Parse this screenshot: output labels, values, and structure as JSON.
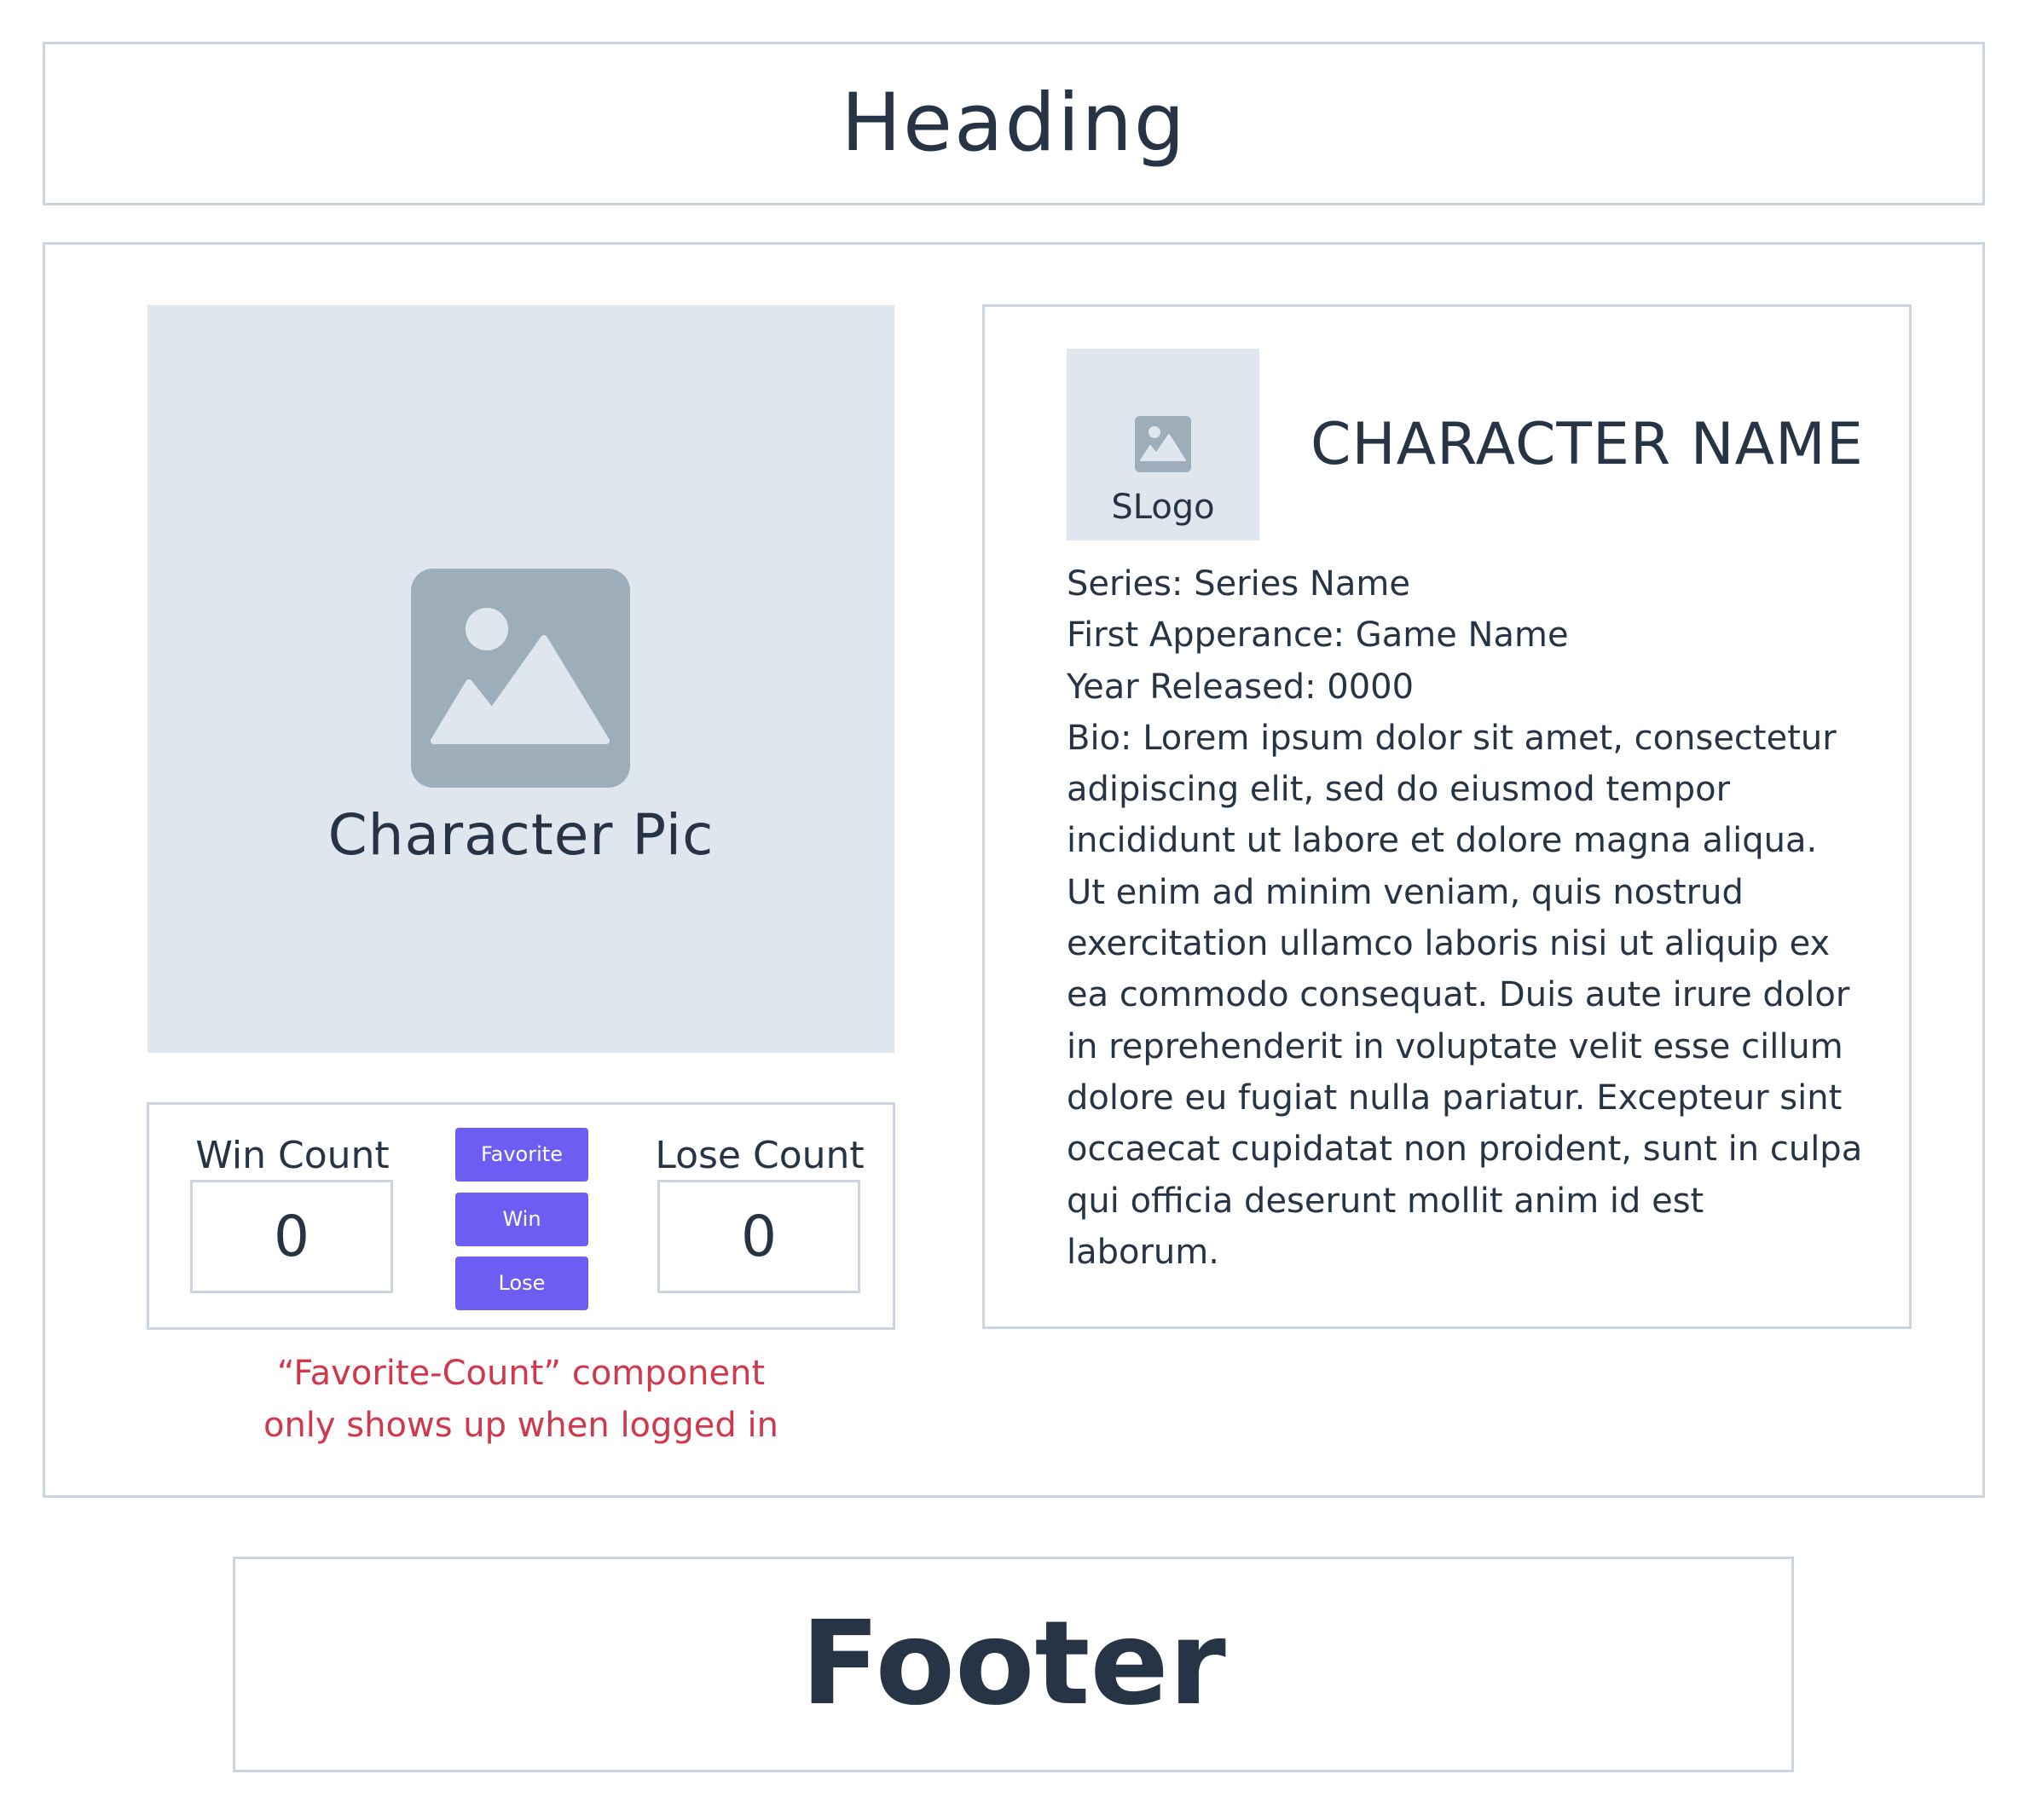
{
  "header": {
    "title": "Heading"
  },
  "character": {
    "picture_label": "Character Pic",
    "name": "CHARACTER NAME",
    "series_logo_label": "SLogo",
    "series_line": "Series: Series Name",
    "first_appearance_line": "First Apperance: Game Name",
    "year_released_line": "Year Released:  0000",
    "bio_lines": [
      "Bio: Lorem ipsum dolor sit amet, consectetur",
      "adipiscing elit, sed do eiusmod tempor",
      "incididunt ut labore et dolore magna aliqua.",
      "Ut enim ad minim veniam, quis nostrud",
      "exercitation ullamco laboris nisi ut aliquip ex",
      "ea commodo consequat. Duis aute irure dolor",
      "in reprehenderit in voluptate velit esse cillum",
      "dolore eu fugiat nulla pariatur. Excepteur sint",
      "occaecat cupidatat non proident, sunt in culpa",
      "qui officia deserunt mollit anim id est",
      "laborum."
    ]
  },
  "favorite_count": {
    "win_label": "Win Count",
    "win_value": "0",
    "lose_label": "Lose Count",
    "lose_value": "0",
    "favorite_button": "Favorite",
    "win_button": "Win",
    "lose_button": "Lose",
    "note_lines": [
      "“Favorite-Count” component",
      "only shows up when logged in"
    ]
  },
  "footer": {
    "title": "Footer"
  },
  "colors": {
    "accent": "#6c5ef2",
    "text": "#263445",
    "placeholder_bg": "#e0e6ee",
    "placeholder_icon": "#9eadba",
    "border": "#cbd5e1",
    "note": "#d0384c"
  },
  "icons": {
    "character_picture": "image-placeholder-icon",
    "series_logo": "image-placeholder-icon"
  }
}
